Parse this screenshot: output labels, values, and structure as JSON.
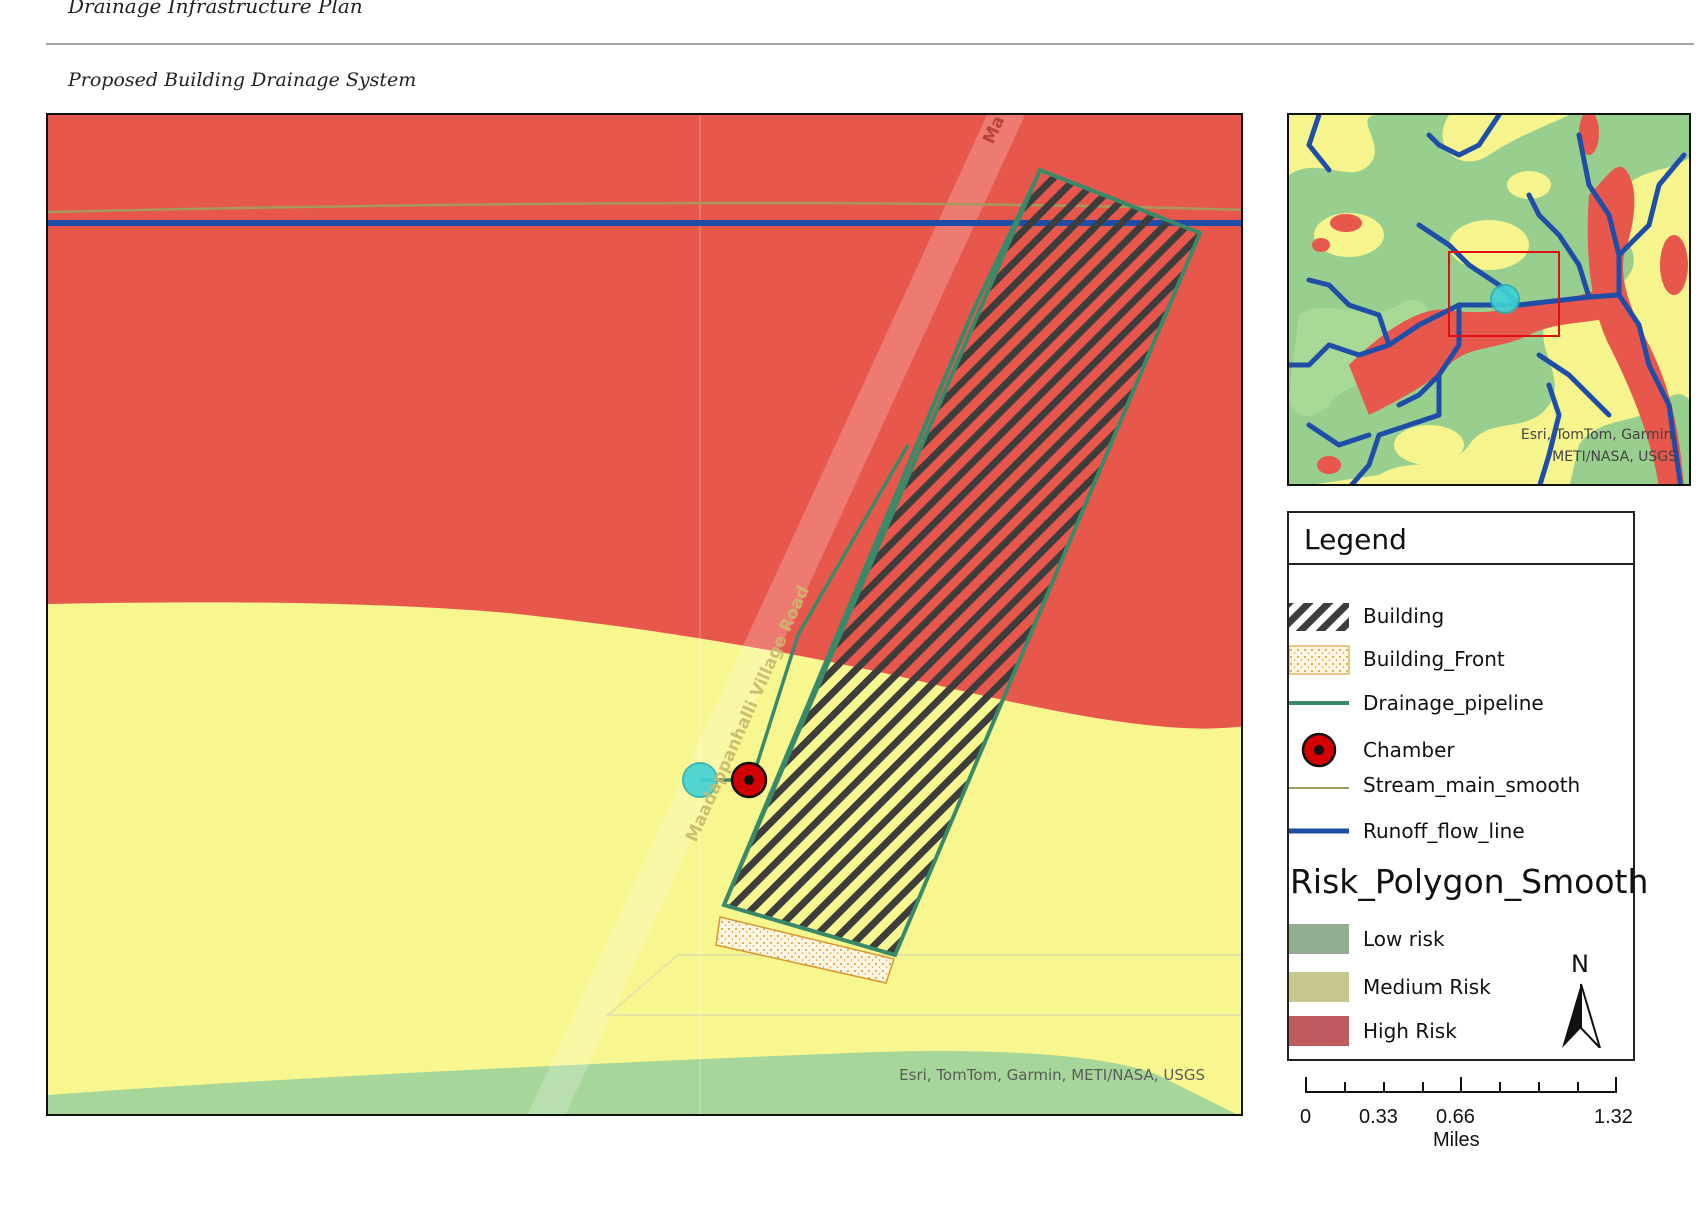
{
  "document": {
    "title": "Drainage Infrastructure Plan",
    "subtitle": "Proposed Building Drainage System"
  },
  "main_map": {
    "road_label_top": "Ma",
    "road_label": "Maadappanhalli Village Road",
    "attribution": "Esri, TomTom, Garmin, METI/NASA, USGS"
  },
  "inset_map": {
    "attribution_line1": "Esri, TomTom, Garmin,",
    "attribution_line2": "METI/NASA, USGS"
  },
  "legend": {
    "title": "Legend",
    "items": [
      {
        "label": "Building",
        "symbol": "hatched-polygon"
      },
      {
        "label": "Building_Front",
        "symbol": "dotted-polygon"
      },
      {
        "label": "Drainage_pipeline",
        "symbol": "green-line"
      },
      {
        "label": "Chamber",
        "symbol": "red-circle-marker"
      },
      {
        "label": "Stream_main_smooth",
        "symbol": "olive-line"
      },
      {
        "label": "Runoff_flow_line",
        "symbol": "blue-line"
      }
    ],
    "group_title": "Risk_Polygon_Smooth",
    "risk_classes": [
      {
        "label": "Low risk",
        "color": "#92ad8f"
      },
      {
        "label": "Medium Risk",
        "color": "#c6c68d"
      },
      {
        "label": "High Risk",
        "color": "#bd5b5e"
      }
    ]
  },
  "north_arrow": {
    "label": "N"
  },
  "scale_bar": {
    "ticks": [
      "0",
      "0.33",
      "0.66",
      "1.32"
    ],
    "unit": "Miles"
  },
  "colors": {
    "high_risk_fill": "#e8574b",
    "medium_risk_fill": "#f8f78f",
    "low_risk_fill": "#a6d69a",
    "runoff_line": "#1f4ea8",
    "pipeline": "#3a8a6a",
    "stream": "#a59a5a",
    "chamber_red": "#d50000",
    "outlet_cyan": "#40d2d6",
    "inset_extent_box": "#e01010"
  }
}
